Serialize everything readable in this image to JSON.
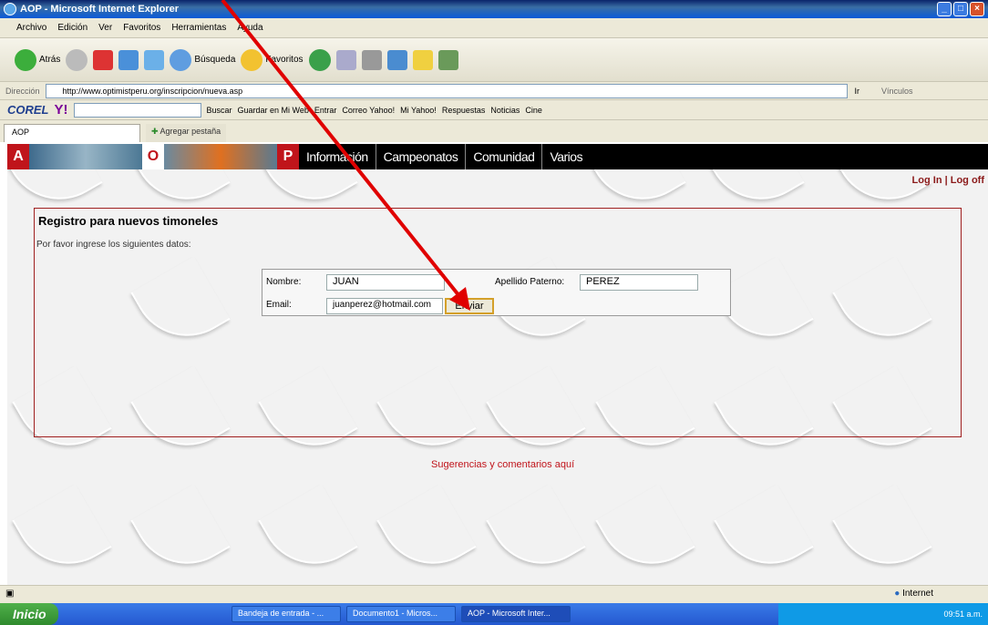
{
  "window": {
    "title": "AOP - Microsoft Internet Explorer"
  },
  "menu": [
    "Archivo",
    "Edición",
    "Ver",
    "Favoritos",
    "Herramientas",
    "Ayuda"
  ],
  "toolbar": {
    "back": "Atrás",
    "search": "Búsqueda",
    "favorites": "Favoritos"
  },
  "address": {
    "label": "Dirección",
    "url": "http://www.optimistperu.org/inscripcion/nueva.asp",
    "go": "Ir",
    "links": "Vínculos"
  },
  "corelbar": {
    "brand": "COREL",
    "yahoo": "Y!",
    "buscar": "Buscar",
    "guardar": "Guardar en Mi Web",
    "entrar": "Entrar",
    "correo": "Correo Yahoo!",
    "miyahoo": "Mi Yahoo!",
    "respuestas": "Respuestas",
    "noticias": "Noticias",
    "cine": "Cine"
  },
  "tabs": {
    "current": "AOP",
    "new": "Agregar pestaña"
  },
  "site": {
    "letters": [
      "A",
      "O",
      "P"
    ],
    "nav": [
      "Información",
      "Campeonatos",
      "Comunidad",
      "Varios"
    ],
    "login": "Log In | Log off",
    "form_title": "Registro para nuevos timoneles",
    "form_subtitle": "Por favor ingrese los siguientes datos:",
    "fields": {
      "nombre_label": "Nombre:",
      "nombre_value": "JUAN",
      "apellido_label": "Apellido Paterno:",
      "apellido_value": "PEREZ",
      "email_label": "Email:",
      "email_value": "juanperez@hotmail.com"
    },
    "send_button": "Enviar",
    "suggestions": "Sugerencias y comentarios aquí"
  },
  "status": {
    "zone": "Internet"
  },
  "taskbar": {
    "start": "Inicio",
    "tasks": [
      "Bandeja de entrada - ...",
      "Documento1 - Micros...",
      "AOP - Microsoft Inter..."
    ],
    "clock": "09:51 a.m."
  },
  "colors": {
    "brand_red": "#c0141b",
    "annotation_arrow": "#e00000"
  }
}
